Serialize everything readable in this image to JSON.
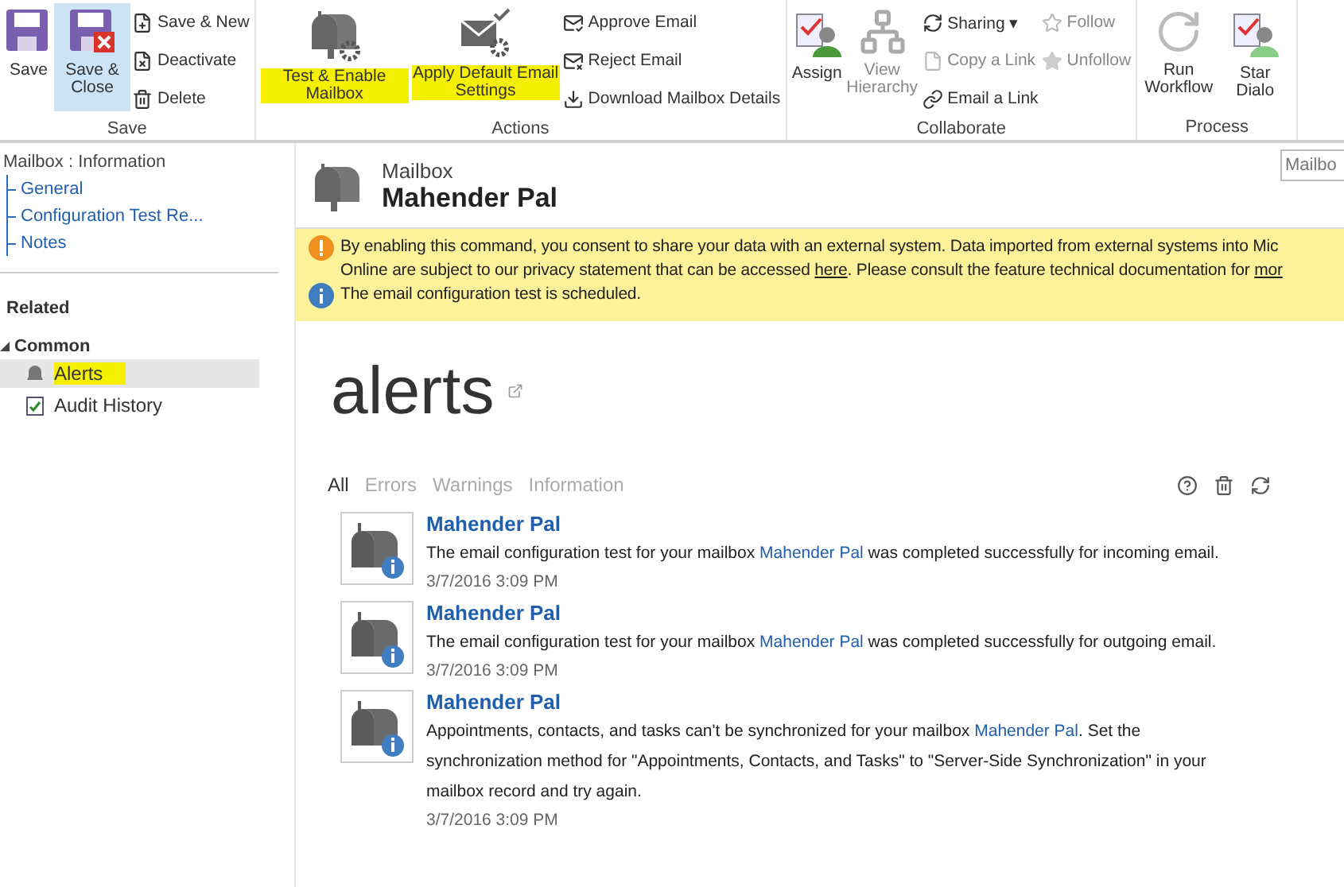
{
  "ribbon": {
    "groups": [
      {
        "label": "Save",
        "items": [
          {
            "kind": "large",
            "label": "Save",
            "pressed": false,
            "disabled": false,
            "highlighted": false
          },
          {
            "kind": "large",
            "label": "Save & Close",
            "pressed": true,
            "disabled": false,
            "highlighted": false
          },
          {
            "kind": "small",
            "label": "Save & New",
            "disabled": false
          },
          {
            "kind": "small",
            "label": "Deactivate",
            "disabled": false
          },
          {
            "kind": "small",
            "label": "Delete",
            "disabled": false
          }
        ]
      },
      {
        "label": "Actions",
        "items": [
          {
            "kind": "large",
            "label": "Test & Enable Mailbox",
            "pressed": false,
            "disabled": false,
            "highlighted": true
          },
          {
            "kind": "large",
            "label": "Apply Default Email Settings",
            "pressed": false,
            "disabled": false,
            "highlighted": true
          },
          {
            "kind": "small",
            "label": "Approve Email",
            "disabled": false
          },
          {
            "kind": "small",
            "label": "Reject Email",
            "disabled": false
          },
          {
            "kind": "small",
            "label": "Download Mailbox Details",
            "disabled": false
          }
        ]
      },
      {
        "label": "Collaborate",
        "items": [
          {
            "kind": "large",
            "label": "Assign",
            "pressed": false,
            "disabled": false,
            "highlighted": false
          },
          {
            "kind": "large",
            "label": "View Hierarchy",
            "pressed": false,
            "disabled": true,
            "highlighted": false
          },
          {
            "kind": "small",
            "label": "Sharing",
            "caret": "▾",
            "disabled": false
          },
          {
            "kind": "small",
            "label": "Copy a Link",
            "disabled": true
          },
          {
            "kind": "small",
            "label": "Email a Link",
            "disabled": false
          },
          {
            "kind": "small",
            "label": "Follow",
            "disabled": true
          },
          {
            "kind": "small",
            "label": "Unfollow",
            "disabled": true
          }
        ]
      },
      {
        "label": "Process",
        "items": [
          {
            "kind": "large",
            "label": "Run Workflow",
            "pressed": false,
            "disabled": false,
            "highlighted": false
          },
          {
            "kind": "large",
            "label": "Star Dialo",
            "pressed": false,
            "disabled": false,
            "highlighted": false
          }
        ]
      }
    ]
  },
  "nav": {
    "title": "Mailbox : Information",
    "links": [
      "General",
      "Configuration Test Re...",
      "Notes"
    ],
    "related": "Related",
    "section": {
      "label": "Common",
      "expanded": true,
      "items": [
        {
          "label": "Alerts",
          "selected": true,
          "highlighted": true
        },
        {
          "label": "Audit History",
          "selected": false,
          "highlighted": false
        }
      ]
    }
  },
  "search": {
    "placeholder": "Mailbo"
  },
  "record": {
    "entity": "Mailbox",
    "name": "Mahender Pal"
  },
  "notifications": [
    {
      "kind": "warning",
      "lines": [
        [
          {
            "kind": "text",
            "text": "By enabling this command, you consent to share your data with an external system. Data imported from external systems into Mic"
          }
        ],
        [
          {
            "kind": "text",
            "text": "Online are subject to our privacy statement that can be accessed "
          },
          {
            "kind": "link",
            "text": "here"
          },
          {
            "kind": "text",
            "text": ". Please consult the feature technical documentation for "
          },
          {
            "kind": "link",
            "text": "mor"
          }
        ]
      ]
    },
    {
      "kind": "info",
      "lines": [
        [
          {
            "kind": "text",
            "text": "The email configuration test is scheduled."
          }
        ]
      ]
    }
  ],
  "alerts": {
    "title": "alerts",
    "filters": [
      {
        "label": "All",
        "selected": true
      },
      {
        "label": "Errors",
        "selected": false
      },
      {
        "label": "Warnings",
        "selected": false
      },
      {
        "label": "Information",
        "selected": false
      }
    ],
    "items": [
      {
        "title": "Mahender Pal",
        "before": "The email configuration test for your mailbox ",
        "link": "Mahender Pal",
        "after": " was completed successfully for incoming email.",
        "time": "3/7/2016 3:09 PM"
      },
      {
        "title": "Mahender Pal",
        "before": "The email configuration test for your mailbox ",
        "link": "Mahender Pal",
        "after": " was completed successfully for outgoing email.",
        "time": "3/7/2016 3:09 PM"
      },
      {
        "title": "Mahender Pal",
        "before": "Appointments, contacts, and tasks can't be synchronized for your mailbox ",
        "link": "Mahender Pal",
        "after": ". Set the synchronization method for \"Appointments, Contacts, and Tasks\" to \"Server-Side Synchronization\" in your mailbox record and try again.",
        "time": "3/7/2016 3:09 PM"
      }
    ]
  }
}
